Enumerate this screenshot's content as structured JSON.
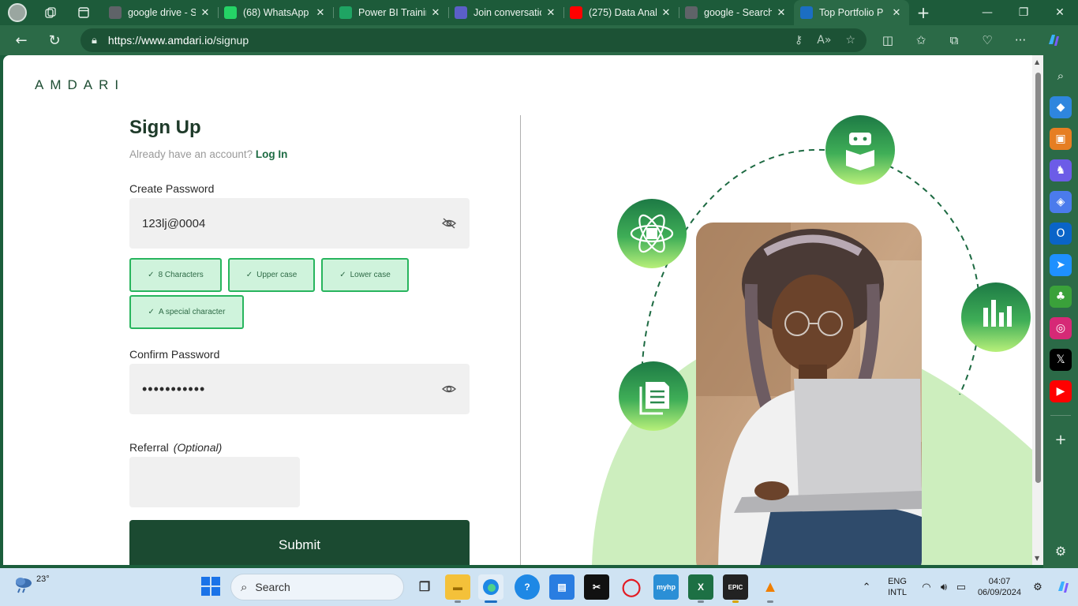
{
  "browser": {
    "tabs": [
      {
        "title": "google drive - Se",
        "favicon": "search-favicon",
        "color": "#5f6368"
      },
      {
        "title": "(68) WhatsApp",
        "favicon": "whatsapp-favicon",
        "color": "#25d366"
      },
      {
        "title": "Power BI Trainin",
        "favicon": "google-drive-favicon",
        "color": "#1fa463"
      },
      {
        "title": "Join conversatio",
        "favicon": "teams-favicon",
        "color": "#5b5fc7"
      },
      {
        "title": "(275) Data Anal",
        "favicon": "youtube-favicon",
        "color": "#ff0000"
      },
      {
        "title": "google - Search",
        "favicon": "search-favicon",
        "color": "#5f6368"
      },
      {
        "title": "Top Portfolio P",
        "favicon": "amdari-favicon",
        "color": "#1b6ec2"
      }
    ],
    "active_tab_index": 6,
    "url_host": "https://www.amdari.io",
    "url_path": "/signup"
  },
  "page": {
    "logo": "AMDARI",
    "title": "Sign Up",
    "have_account": "Already have an account?",
    "login_link": "Log In",
    "create_password_label": "Create Password",
    "create_password_value": "123lj@0004",
    "requirements": [
      "8 Characters",
      "Upper case",
      "Lower case",
      "A special character"
    ],
    "confirm_password_label": "Confirm Password",
    "confirm_password_value": "•••••••••••",
    "referral_label": "Referral",
    "referral_optional": "(Optional)",
    "submit_label": "Submit"
  },
  "colors": {
    "brand_dark": "#1b4a31",
    "req_border": "#28b55e",
    "req_bg": "#cff3dc",
    "illustration_green": "#cdeebe"
  },
  "taskbar": {
    "weather_temp": "23°",
    "search_label": "Search",
    "lang_top": "ENG",
    "lang_bottom": "INTL",
    "time": "04:07",
    "date": "06/09/2024"
  }
}
